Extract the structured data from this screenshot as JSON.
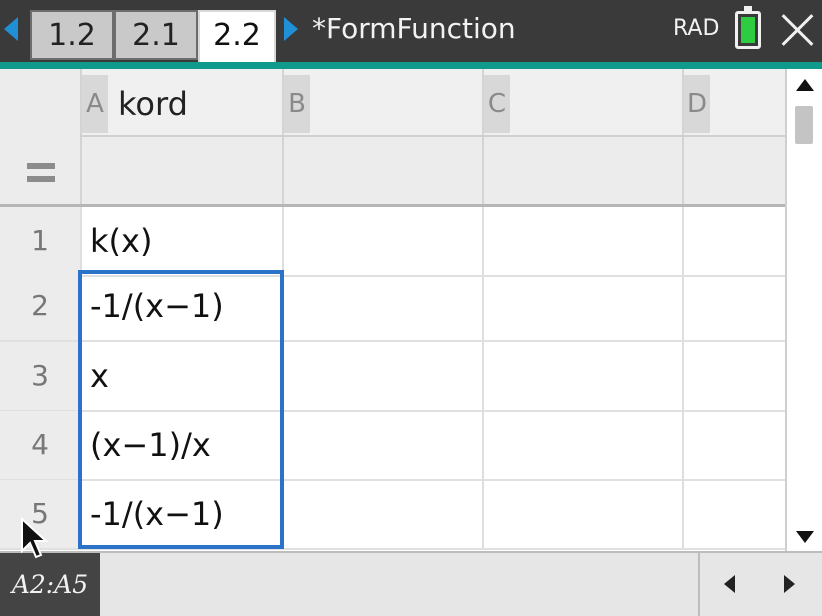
{
  "tabs": [
    {
      "label": "1.2"
    },
    {
      "label": "2.1"
    },
    {
      "label": "2.2"
    }
  ],
  "document": {
    "title": "*FormFunction"
  },
  "status": {
    "angle_mode": "RAD"
  },
  "colors": {
    "accent_teal": "#0f9a8c",
    "selection_blue": "#2a73c9",
    "tab_arrows": "#1f8fd6",
    "battery_green": "#2ecc40"
  },
  "icons": [
    "tab-left-arrow-icon",
    "tab-right-arrow-icon",
    "battery-icon",
    "close-icon",
    "formula-equals-icon",
    "scroll-up-icon",
    "scroll-down-icon",
    "nav-left-icon",
    "nav-right-icon",
    "mouse-pointer-icon"
  ],
  "sheet": {
    "columns": [
      {
        "letter": "A",
        "name": "kord"
      },
      {
        "letter": "B",
        "name": ""
      },
      {
        "letter": "C",
        "name": ""
      },
      {
        "letter": "D",
        "name": ""
      }
    ],
    "rows": [
      {
        "num": "1",
        "cells": [
          "k(x)",
          "",
          "",
          ""
        ]
      },
      {
        "num": "2",
        "cells": [
          "-1/(x−1)",
          "",
          "",
          ""
        ]
      },
      {
        "num": "3",
        "cells": [
          "x",
          "",
          "",
          ""
        ]
      },
      {
        "num": "4",
        "cells": [
          "(x−1)/x",
          "",
          "",
          ""
        ]
      },
      {
        "num": "5",
        "cells": [
          "-1/(x−1)",
          "",
          "",
          ""
        ]
      }
    ]
  },
  "selection": {
    "range": "A2:A5"
  }
}
